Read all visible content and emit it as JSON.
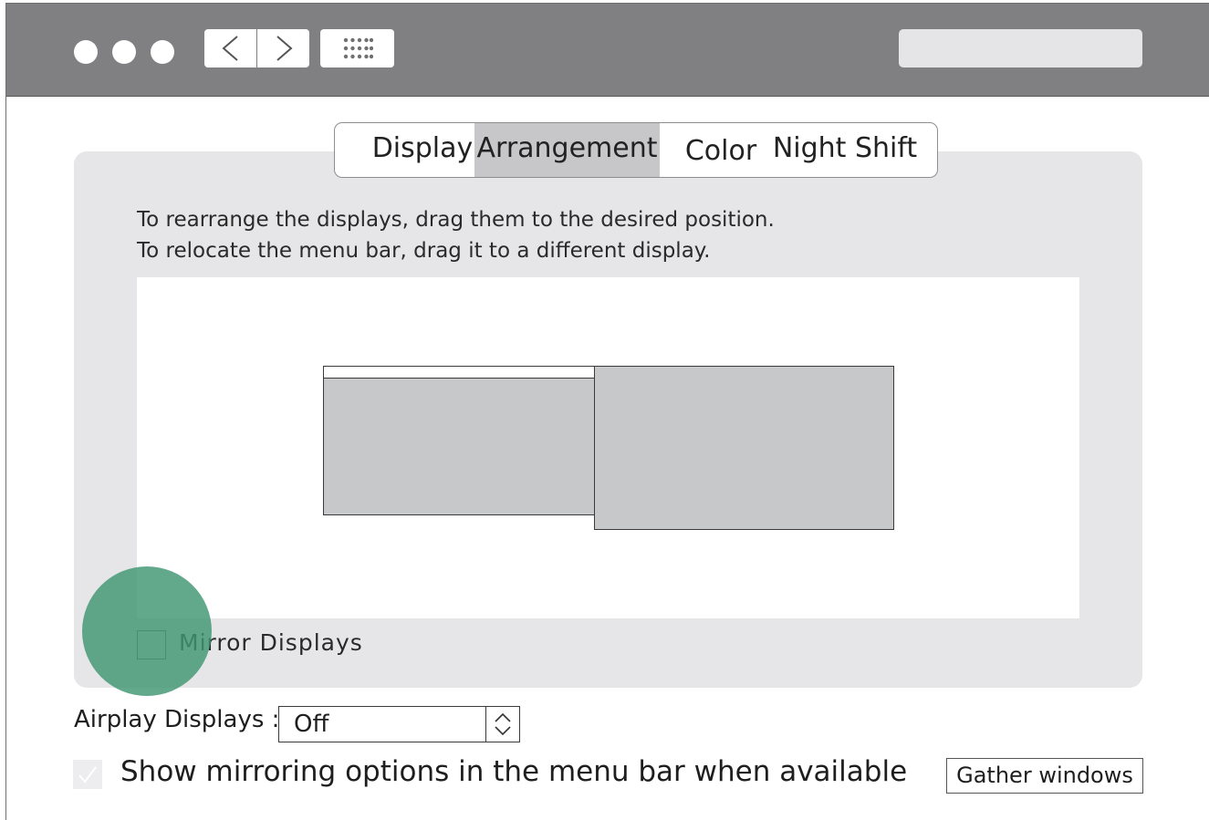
{
  "titlebar": {
    "traffic_lights": [
      "close-light",
      "minimize-light",
      "zoom-light"
    ],
    "back_icon": "chevron-left-icon",
    "forward_icon": "chevron-right-icon",
    "grid_icon": "app-grid-icon",
    "search_placeholder": ""
  },
  "tabs": [
    {
      "label": "Display",
      "active": false
    },
    {
      "label": "Arrangement",
      "active": true
    },
    {
      "label": "Color",
      "active": false
    },
    {
      "label": "Night Shift",
      "active": false
    }
  ],
  "instructions": {
    "line1": "To rearrange the displays, drag them to the desired position.",
    "line2": "To relocate the menu bar, drag it to a different display."
  },
  "arrangement": {
    "displays": [
      "primary-display-with-menu-bar",
      "secondary-display"
    ]
  },
  "mirror": {
    "label": "Mirror Displays",
    "checked": false
  },
  "airplay": {
    "label": "Airplay Displays :",
    "value": "Off"
  },
  "mirroring_options": {
    "label": "Show mirroring options in the menu bar when available",
    "checked": true
  },
  "gather_button": {
    "label": "Gather windows"
  },
  "colors": {
    "titlebar": "#808083",
    "panel": "#e6e6e8",
    "active_tab": "#c7c7c9",
    "display_fill": "#c7c8ca",
    "touch_indicator": "#409673"
  }
}
